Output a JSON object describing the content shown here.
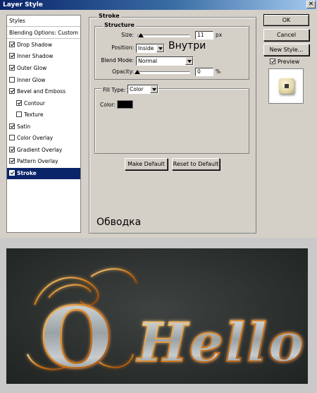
{
  "window": {
    "title": "Layer Style",
    "close_glyph": "✕"
  },
  "left_list": {
    "items": [
      {
        "label": "Styles",
        "checkbox": false,
        "checked": false
      },
      {
        "label": "Blending Options: Custom",
        "checkbox": false,
        "checked": false
      },
      {
        "label": "Drop Shadow",
        "checkbox": true,
        "checked": true
      },
      {
        "label": "Inner Shadow",
        "checkbox": true,
        "checked": true
      },
      {
        "label": "Outer Glow",
        "checkbox": true,
        "checked": true
      },
      {
        "label": "Inner Glow",
        "checkbox": true,
        "checked": false
      },
      {
        "label": "Bevel and Emboss",
        "checkbox": true,
        "checked": true
      },
      {
        "label": "Contour",
        "checkbox": true,
        "checked": true
      },
      {
        "label": "Texture",
        "checkbox": true,
        "checked": false
      },
      {
        "label": "Satin",
        "checkbox": true,
        "checked": true
      },
      {
        "label": "Color Overlay",
        "checkbox": true,
        "checked": false
      },
      {
        "label": "Gradient Overlay",
        "checkbox": true,
        "checked": true
      },
      {
        "label": "Pattern Overlay",
        "checkbox": true,
        "checked": true
      },
      {
        "label": "Stroke",
        "checkbox": true,
        "checked": true,
        "selected": true
      }
    ]
  },
  "stroke": {
    "group_label": "Stroke",
    "structure_label": "Structure",
    "size_label": "Size:",
    "size_value": "11",
    "size_unit": "px",
    "size_level": 0.06,
    "position_label": "Position:",
    "position_value": "Inside",
    "blend_label": "Blend Mode:",
    "blend_value": "Normal",
    "opacity_label": "Opacity:",
    "opacity_value": "0",
    "opacity_unit": "%",
    "opacity_level": 0,
    "fill_type_label": "Fill Type:",
    "fill_type_value": "Color",
    "color_label": "Color:",
    "color_swatch": "#000000",
    "make_default": "Make Default",
    "reset_default": "Reset to Default"
  },
  "annotations": {
    "inside_note": "Внутри",
    "stroke_note": "Обводка"
  },
  "buttons": {
    "ok": "OK",
    "cancel": "Cancel",
    "new_style": "New Style...",
    "preview_label": "Preview",
    "preview_checked": true
  },
  "artwork": {
    "text": "Hello",
    "initial": "O"
  }
}
